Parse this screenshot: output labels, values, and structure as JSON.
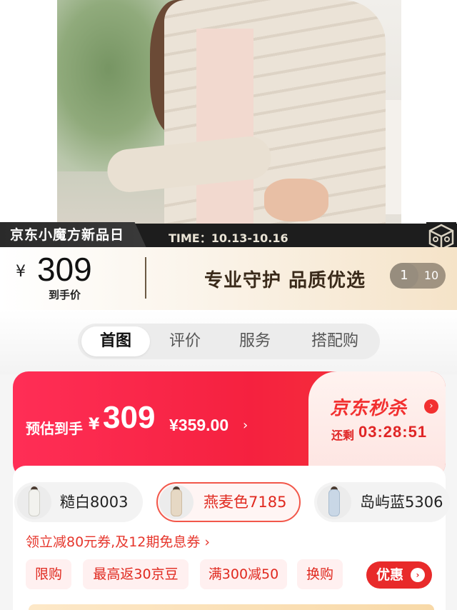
{
  "promo": {
    "event_name": "京东小魔方新品日",
    "time": "TIME：10.13-10.16",
    "currency": "¥",
    "price": "309",
    "price_label": "到手价",
    "slogan": "专业守护 品质优选"
  },
  "gallery": {
    "current": "1",
    "total": "10"
  },
  "tabs": [
    {
      "label": "首图",
      "active": true
    },
    {
      "label": "评价",
      "active": false
    },
    {
      "label": "服务",
      "active": false
    },
    {
      "label": "搭配购",
      "active": false
    }
  ],
  "flash_sale": {
    "estimate_label": "预估到手",
    "currency": "¥",
    "price": "309",
    "original_price": "¥359.00",
    "original_arrow": "›",
    "title": "京东秒杀",
    "remaining_label": "还剩",
    "countdown": "03:28:51"
  },
  "variants": [
    {
      "label": "糙白8003",
      "selected": false,
      "color": "#f2f2ee"
    },
    {
      "label": "燕麦色7185",
      "selected": true,
      "color": "#e6d8c4"
    },
    {
      "label": "岛屿蓝5306",
      "selected": false,
      "color": "#c9d7e6"
    }
  ],
  "coupons": {
    "line": "领立减80元券,及12期免息券 ›",
    "tags": [
      "限购",
      "最高返30京豆",
      "满300减50",
      "换购"
    ],
    "discount_button": "优惠"
  },
  "colors": {
    "accent_red": "#f23030",
    "sale_gradient_start": "#ff2e56",
    "banner_dark": "#1d1d1d"
  }
}
